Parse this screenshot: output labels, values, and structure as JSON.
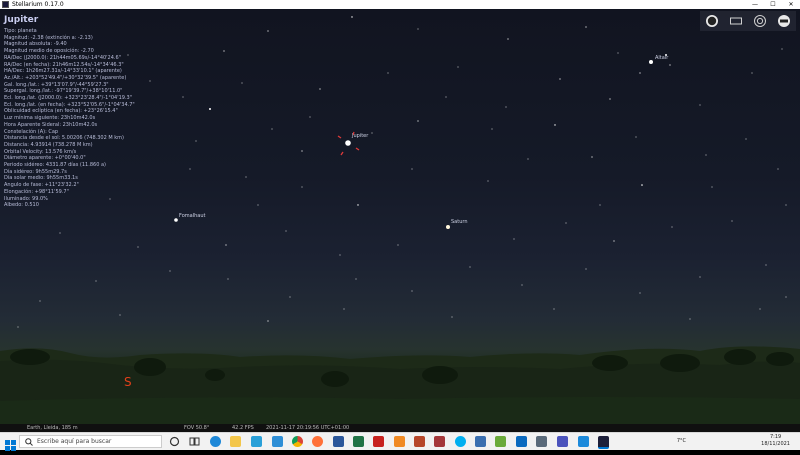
{
  "window": {
    "title": "Stellarium 0.17.0"
  },
  "info_panel": {
    "object_name": "Jupiter",
    "lines": [
      "Tipo: planeta",
      "Magnitud: -2.38 (extinción a: -2.13)",
      "Magnitud absoluta: -9.40",
      "Magnitud medio de oposición: -2.70",
      "RA/Dec (J2000.0): 21h44m05.69s/-14°40'24.6\"",
      "RA/Dec (en fecha): 21h46m12.54s/-14°34'46.3\"",
      "HA/Dec: 1h26m27.31s/-14°33'10.1\" (aparente)",
      "Az./Alt.: +203°52'49.4\"/+30°32'39.5\" (aparente)",
      "Gal. long./lat.: +39°13'07.9\"/-44°59'27.3\"",
      "Supergal. long./lat.: -97°19'39.7\"/+38°10'11.0\"",
      "Ecl. long./lat. (J2000.0): +323°23'28.4\"/-1°04'19.3\"",
      "Ecl. long./lat. (en fecha): +323°52'05.6\"/-1°04'34.7\"",
      "Oblicuidad eclíptica (en fecha): +23°26'15.4\"",
      "Luz mínima siguiente: 23h10m42.0s",
      "Hora Aparente Sideral: 23h10m42.0s",
      "Constelación (A): Cap",
      "Distancia desde el sol: 5.00206 (748.302 M km)",
      "Distancia: 4.93914 (738.278 M km)",
      "Orbital Velocity: 13.576 km/s",
      "Diámetro aparente: +0°00'40.0\"",
      "Periodo sidéreo: 4331.87 días (11.860 a)",
      "Día sidéreo: 9h55m29.7s",
      "Día solar medio: 9h55m33.1s",
      "Angulo de fase: +11°23'32.2\"",
      "Elongación: +98°11'59.7\"",
      "Iluminado: 99.0%",
      "Albedo: 0.510"
    ]
  },
  "sky_labels": {
    "jupiter": "Jupiter",
    "altair": "Altair",
    "fomalhaut": "Fomalhaut",
    "saturn": "Saturn",
    "cardinal_south": "S"
  },
  "status_bar": {
    "location": "Earth, Lleida, 185 m",
    "fov": "FOV 50.8°",
    "fps": "42.2 FPS",
    "datetime": "2021-11-17 20:19:56 UTC+01:00"
  },
  "taskbar": {
    "search_placeholder": "Escribe aquí para buscar",
    "temperature": "7°C",
    "time": "7:19",
    "date": "18/11/2021"
  },
  "icons": {
    "window": [
      "app-icon",
      "minimize-icon",
      "maximize-icon",
      "close-icon"
    ],
    "toolbar": [
      "fullscreen-icon",
      "window-icon",
      "target-icon",
      "night-mode-icon"
    ],
    "taskbar": [
      "windows-start-icon",
      "search-icon",
      "cortana-icon",
      "task-view-icon",
      "edge-icon",
      "file-explorer-icon",
      "chrome-icon",
      "firefox-icon",
      "word-icon",
      "excel-icon",
      "acrobat-icon",
      "vlc-icon",
      "powerpoint-icon",
      "access-icon",
      "skype-icon",
      "app-icon",
      "greenshot-icon",
      "photos-icon",
      "bird-icon",
      "teams-icon",
      "stellarium-icon"
    ]
  },
  "colors": {
    "cardinal": "#e0401a",
    "info_text": "#b8bcd8",
    "selection_marker": "#e03a3a"
  }
}
